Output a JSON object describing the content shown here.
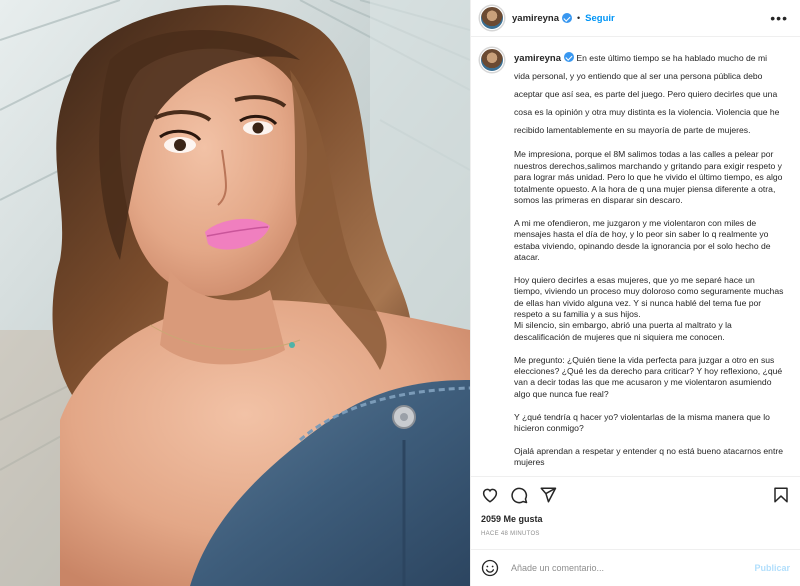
{
  "post": {
    "username": "yamireyna",
    "follow_label": "Seguir",
    "dot": "•",
    "more_icon": "more-horizontal-icon"
  },
  "caption": {
    "username": "yamireyna",
    "paragraphs": [
      "En este último tiempo se ha hablado mucho de mi vida personal, y yo entiendo que al ser una persona pública debo aceptar que así sea, es parte del juego. Pero quiero decirles que una cosa es la opinión y otra muy distinta es la violencia. Violencia que he recibido lamentablemente en su mayoría de parte de mujeres.",
      "Me impresiona, porque el 8M salimos todas a las calles a pelear por nuestros derechos,salimos marchando y gritando para exigir respeto y para lograr más unidad. Pero lo que he vivido el último tiempo, es algo totalmente opuesto. A la hora de q una mujer piensa diferente a otra, somos las primeras en disparar sin descaro.",
      "A mi me ofendieron, me juzgaron y me violentaron con miles de mensajes hasta el día de hoy, y lo peor sin saber lo q realmente yo estaba viviendo, opinando desde la ignorancia por el solo hecho de atacar.",
      "Hoy quiero decirles a esas mujeres, que yo me separé hace un tiempo, viviendo un proceso muy doloroso como seguramente muchas de ellas han vivido alguna vez. Y si nunca hablé del tema fue por respeto a su familia y a sus hijos.\nMi silencio, sin embargo, abrió una puerta al maltrato y la descalificación de mujeres que ni siquiera me conocen.",
      "Me pregunto: ¿Quién tiene la vida perfecta para juzgar a otro en sus elecciones? ¿Qué les da derecho para criticar? Y hoy reflexiono, ¿qué van a decir todas las que me acusaron y me violentaron asumiendo algo que nunca fue real?",
      "Y ¿qué tendría q hacer yo? violentarlas de la misma manera que lo hicieron conmigo?",
      "Ojalá aprendan a respetar y entender q no está bueno atacarnos entre mujeres"
    ]
  },
  "actions": {
    "like_icon": "heart-icon",
    "comment_icon": "comment-icon",
    "share_icon": "share-icon",
    "save_icon": "bookmark-icon"
  },
  "likes_text": "2059 Me gusta",
  "timestamp": "HACE 48 MINUTOS",
  "comment_box": {
    "placeholder": "Añade un comentario...",
    "publish_label": "Publicar",
    "emoji_icon": "emoji-icon"
  },
  "colors": {
    "accent": "#0095f6",
    "publish_disabled": "#b2dffc",
    "verified": "#3897f0",
    "text": "#262626",
    "muted": "#8e8e8e"
  }
}
